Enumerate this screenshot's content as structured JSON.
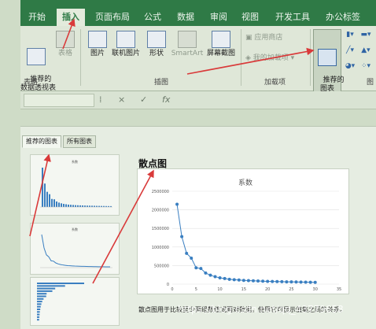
{
  "ribbon": {
    "tabs": [
      "开始",
      "插入",
      "页面布局",
      "公式",
      "数据",
      "审阅",
      "视图",
      "开发工具",
      "办公标签"
    ],
    "active_tab": "插入",
    "groups": {
      "tables": {
        "label": "表格",
        "recommended_pivot": "推荐的\n数据透视表",
        "table": "表格"
      },
      "illustrations": {
        "label": "插图",
        "picture": "图片",
        "online_picture": "联机图片",
        "shapes": "形状",
        "smartart": "SmartArt",
        "screenshot": "屏幕截图"
      },
      "addins": {
        "label": "加载项",
        "store": "应用商店",
        "my_addins": "我的加载项"
      },
      "charts": {
        "label": "图",
        "recommended_charts": "推荐的\n图表"
      }
    }
  },
  "formula_bar": {
    "cancel": "×",
    "enter": "✓",
    "fx": "fx"
  },
  "dialog": {
    "tabs": [
      "推荐的图表",
      "所有图表"
    ],
    "active_tab": "推荐的图表",
    "thumbnail_title": "系数",
    "chart_type_name": "散点图",
    "description": "散点图用于比较至少两组数值或两对数据。使用它可显示值集之间的关系。"
  },
  "watermark": "https://blog.csdn.net/qq_43779658",
  "chart_data": {
    "type": "scatter",
    "title": "系数",
    "xlabel": "",
    "ylabel": "",
    "xlim": [
      0,
      35
    ],
    "ylim": [
      0,
      2500000
    ],
    "xticks": [
      0,
      5,
      10,
      15,
      20,
      25,
      30,
      35
    ],
    "yticks": [
      0,
      500000,
      1000000,
      1500000,
      2000000,
      2500000
    ],
    "ytick_labels": [
      "0",
      "500000",
      "1000000",
      "1500000",
      "2000000",
      "2500000"
    ],
    "smooth_line": true,
    "color": "#3a7fc1",
    "x": [
      1,
      2,
      3,
      4,
      5,
      6,
      7,
      8,
      9,
      10,
      11,
      12,
      13,
      14,
      15,
      16,
      17,
      18,
      19,
      20,
      21,
      22,
      23,
      24,
      25,
      26,
      27,
      28,
      29,
      30
    ],
    "values": [
      2150000,
      1280000,
      830000,
      700000,
      440000,
      420000,
      300000,
      240000,
      200000,
      170000,
      150000,
      130000,
      120000,
      110000,
      100000,
      95000,
      90000,
      85000,
      80000,
      75000,
      72000,
      70000,
      66000,
      62000,
      60000,
      57000,
      55000,
      52000,
      50000,
      48000
    ]
  }
}
